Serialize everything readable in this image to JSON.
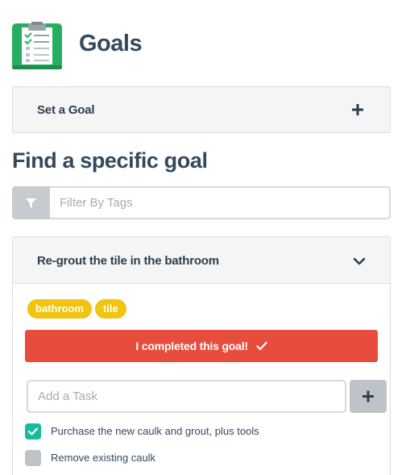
{
  "header": {
    "title": "Goals",
    "logo_icon": "clipboard-checklist-icon"
  },
  "set_goal_panel": {
    "label": "Set a Goal",
    "action_icon": "plus-icon"
  },
  "find_section": {
    "title": "Find a specific goal"
  },
  "filter": {
    "icon": "filter-funnel-icon",
    "placeholder": "Filter By Tags",
    "value": ""
  },
  "goal": {
    "title": "Re-grout the tile in the bathroom",
    "expand_icon": "chevron-down-icon",
    "tags": [
      "bathroom",
      "tile"
    ],
    "complete_label": "I completed this goal!",
    "complete_icon": "check-icon",
    "task_input": {
      "placeholder": "Add a Task",
      "value": ""
    },
    "tasks": [
      {
        "label": "Purchase the new caulk and grout, plus tools",
        "completed": true
      },
      {
        "label": "Remove existing caulk",
        "completed": false
      }
    ]
  },
  "colors": {
    "title_text": "#34495e",
    "panel_bg": "#f5f5f5",
    "tag_yellow": "#f1c40f",
    "complete_red": "#e74c3c",
    "check_green": "#1abc9c",
    "logo_green": "#27ae60",
    "muted_grey": "#bdc3c7"
  }
}
